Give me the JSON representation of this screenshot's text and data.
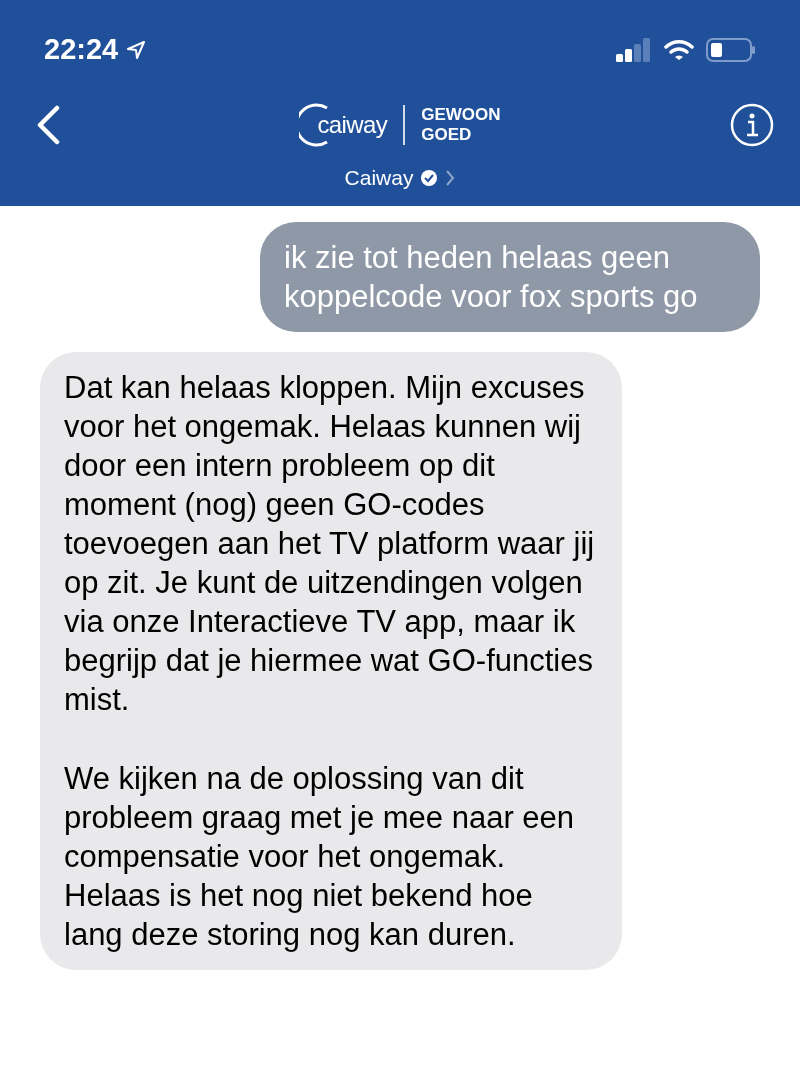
{
  "status_bar": {
    "time": "22:24"
  },
  "header": {
    "logo_text": "caiway",
    "tagline": [
      "GEWOON",
      "GOED"
    ],
    "contact_name": "Caiway",
    "verified": true
  },
  "messages": [
    {
      "kind": "outgoing",
      "paragraphs": [
        "ik zie tot heden helaas geen koppelcode voor fox sports go"
      ]
    },
    {
      "kind": "incoming",
      "paragraphs": [
        "Dat kan helaas kloppen. Mijn excuses voor het ongemak. Helaas kunnen wij door een intern probleem op dit moment (nog) geen GO-codes toevoegen aan het TV platform waar jij op zit. Je kunt de uitzendingen volgen via onze Interactieve TV app, maar ik begrijp dat je hiermee wat GO-functies mist.",
        "We kijken na de oplossing van dit probleem graag met je mee naar een compensatie voor het ongemak. Helaas is het nog niet bekend hoe lang deze storing nog kan duren."
      ]
    }
  ]
}
